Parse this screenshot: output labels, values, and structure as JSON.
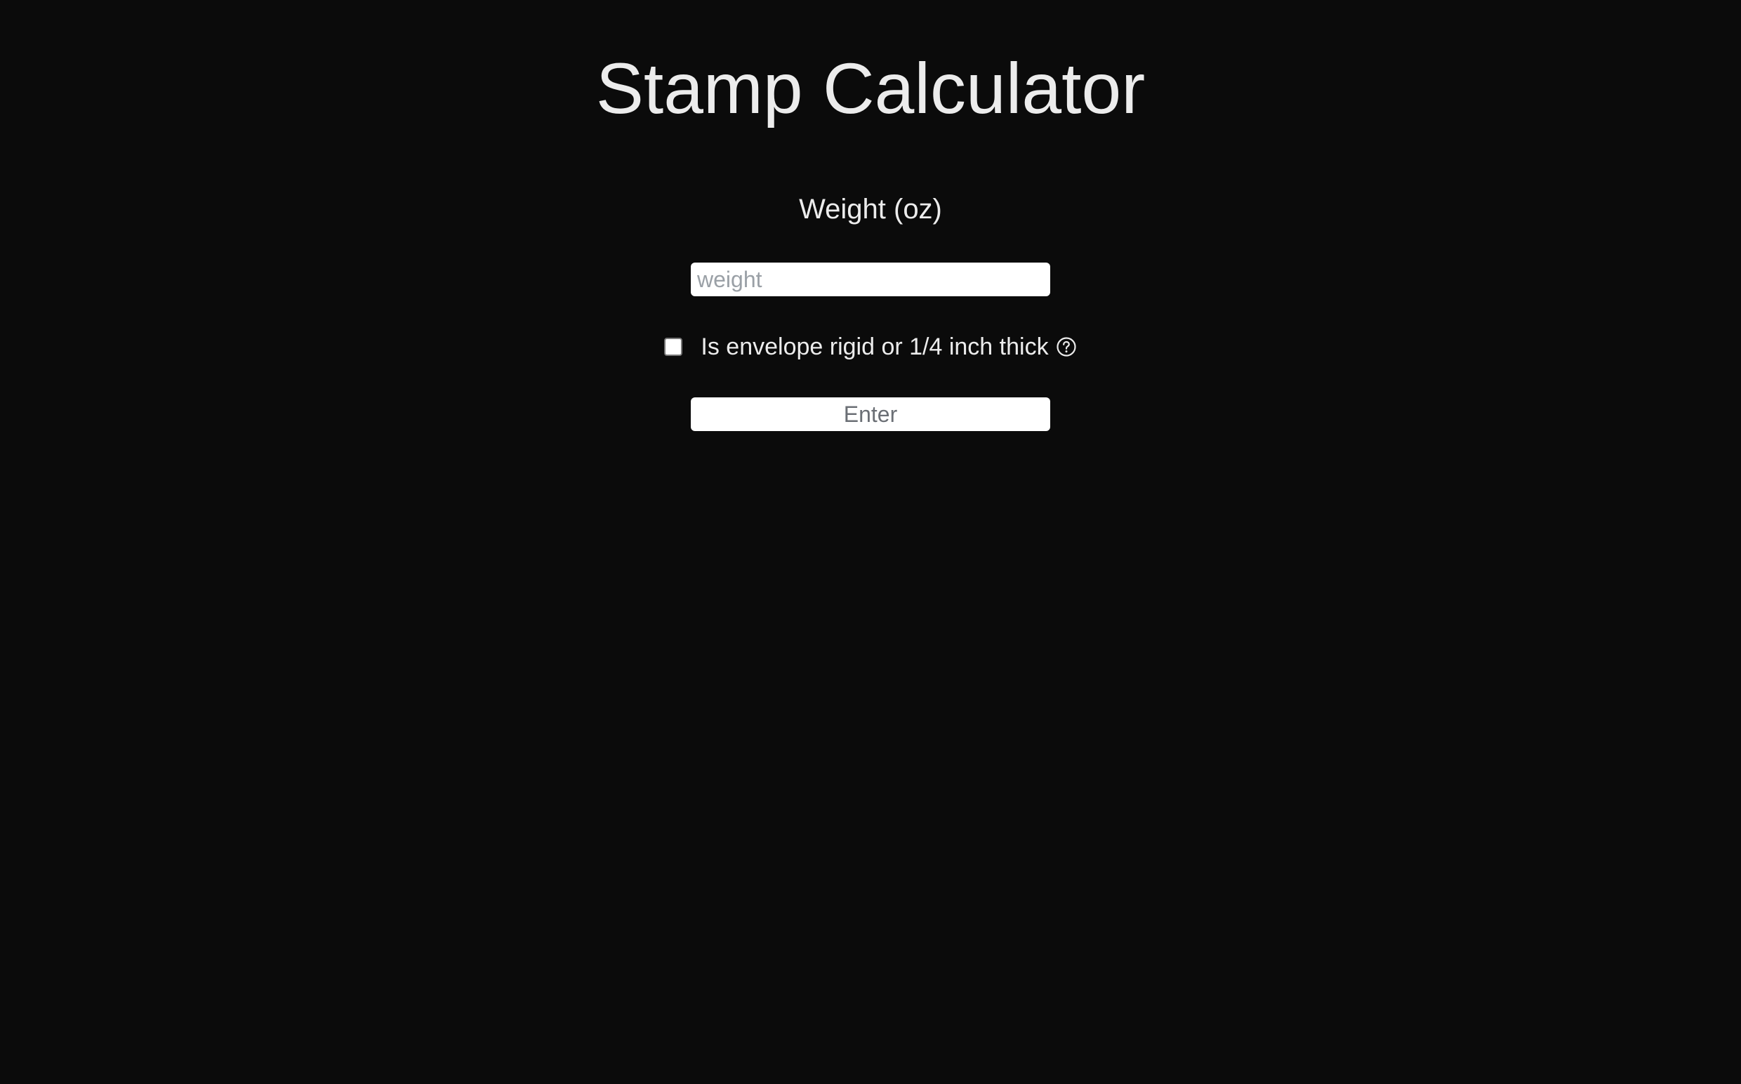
{
  "page": {
    "title": "Stamp Calculator"
  },
  "form": {
    "weight_label": "Weight (oz)",
    "weight_input": {
      "value": "",
      "placeholder": "weight"
    },
    "rigid_checkbox": {
      "checked": false,
      "label": "Is envelope rigid or 1/4 inch thick",
      "help_icon": "question-circle-icon"
    },
    "enter_button_label": "Enter"
  },
  "colors": {
    "background": "#0b0b0b",
    "text": "#ececec",
    "control_background": "#ffffff",
    "placeholder": "#9aa0a6",
    "button_text": "#6b6f75"
  }
}
